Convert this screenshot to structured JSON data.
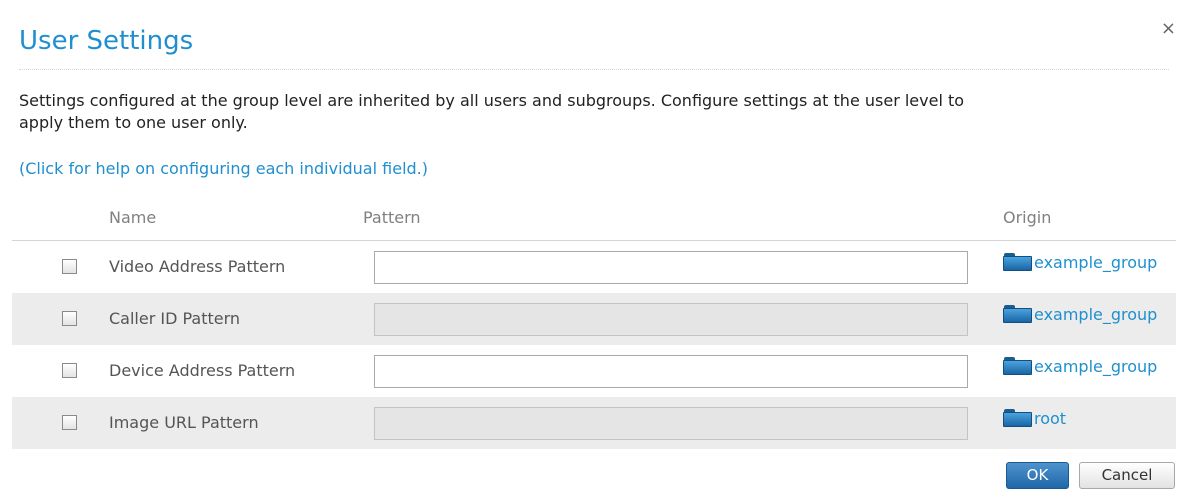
{
  "dialog": {
    "title": "User Settings",
    "close_glyph": "×",
    "description": "Settings configured at the group level are inherited by all users and subgroups. Configure settings at the user level to apply them to one user only.",
    "help_link": "(Click for help on configuring each individual field.)"
  },
  "table": {
    "headers": {
      "name": "Name",
      "pattern": "Pattern",
      "origin": "Origin"
    },
    "rows": [
      {
        "name": "Video Address Pattern",
        "pattern_value": "",
        "pattern_disabled": false,
        "origin": "example_group",
        "checked": false
      },
      {
        "name": "Caller ID Pattern",
        "pattern_value": "",
        "pattern_disabled": true,
        "origin": "example_group",
        "checked": false
      },
      {
        "name": "Device Address Pattern",
        "pattern_value": "",
        "pattern_disabled": false,
        "origin": "example_group",
        "checked": false
      },
      {
        "name": "Image URL Pattern",
        "pattern_value": "",
        "pattern_disabled": true,
        "origin": "root",
        "checked": false
      }
    ]
  },
  "buttons": {
    "ok": "OK",
    "cancel": "Cancel"
  },
  "colors": {
    "accent": "#1f8fcf",
    "alt_row": "#ececec",
    "ok_button": "#2f77b8"
  },
  "icons": {
    "origin": "folder-icon",
    "close": "close-icon"
  }
}
